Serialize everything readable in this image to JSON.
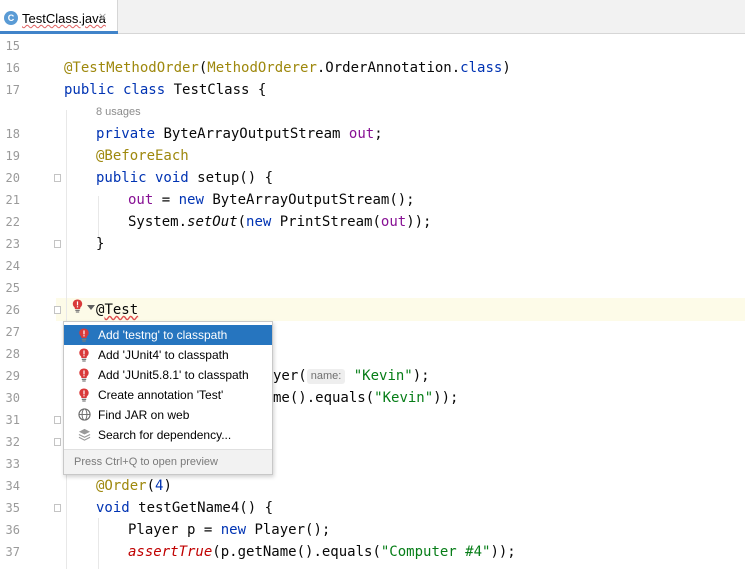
{
  "tab": {
    "icon": "C",
    "title": "TestClass.java",
    "close": "×"
  },
  "line_numbers": [
    "15",
    "16",
    "17",
    "18",
    "19",
    "20",
    "21",
    "22",
    "23",
    "24",
    "25",
    "26",
    "27",
    "28",
    "29",
    "30",
    "31",
    "32",
    "33",
    "34",
    "35",
    "36",
    "37"
  ],
  "usages_hint": "8 usages",
  "code": {
    "l16": {
      "annotation": "@TestMethodOrder",
      "p1": "(",
      "cls": "MethodOrderer",
      "p2": ".OrderAnnotation.",
      "kw": "class",
      "p3": ")"
    },
    "l17": {
      "kw1": "public class",
      "name": " TestClass {"
    },
    "l18": {
      "kw": "private",
      "type": " ByteArrayOutputStream ",
      "field": "out",
      "end": ";"
    },
    "l19": {
      "annotation": "@BeforeEach"
    },
    "l20": {
      "kw": "public void",
      "rest": " setup() {"
    },
    "l21": {
      "field": "out",
      "mid": " = ",
      "kw": "new",
      "rest": " ByteArrayOutputStream();"
    },
    "l22": {
      "a": "System.",
      "method": "setOut",
      "b": "(",
      "kw": "new",
      "c": " PrintStream(",
      "field": "out",
      "d": "));"
    },
    "l23": {
      "text": "}"
    },
    "l26": {
      "at": "@",
      "name": "Test"
    },
    "l29": {
      "a": "yer(",
      "hint": "name:",
      "str": "\"Kevin\"",
      "b": ");"
    },
    "l30": {
      "a": "me().equals(",
      "str": "\"Kevin\"",
      "b": "));"
    },
    "l34": {
      "annotation": "@Order",
      "a": "(",
      "num": "4",
      "b": ")"
    },
    "l35": {
      "kw": "void",
      "rest": " testGetName4() {"
    },
    "l36": {
      "a": "Player p = ",
      "kw": "new",
      "b": " Player();"
    },
    "l37": {
      "method": "assertTrue",
      "a": "(p.getName().equals(",
      "str": "\"Computer #4\"",
      "b": "));"
    }
  },
  "popup": {
    "items": [
      {
        "label": "Add 'testng' to classpath",
        "icon": "error-bulb-icon"
      },
      {
        "label": "Add 'JUnit4' to classpath",
        "icon": "error-bulb-icon"
      },
      {
        "label": "Add 'JUnit5.8.1' to classpath",
        "icon": "error-bulb-icon"
      },
      {
        "label": "Create annotation 'Test'",
        "icon": "error-bulb-icon"
      },
      {
        "label": "Find JAR on web",
        "icon": "globe-icon"
      },
      {
        "label": "Search for dependency...",
        "icon": "layers-icon"
      }
    ],
    "footer": "Press Ctrl+Q to open preview"
  },
  "colors": {
    "keyword": "#0033b3",
    "annotation": "#9e880d",
    "field": "#871094",
    "string": "#067d17",
    "selection": "#2675bf"
  }
}
